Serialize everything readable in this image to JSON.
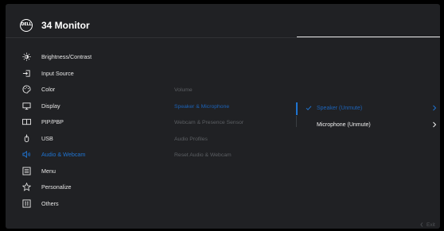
{
  "header": {
    "brand": "DELL",
    "title": "34 Monitor"
  },
  "menu": {
    "items": [
      {
        "label": "Brightness/Contrast",
        "icon": "brightness-icon"
      },
      {
        "label": "Input Source",
        "icon": "input-source-icon"
      },
      {
        "label": "Color",
        "icon": "color-icon"
      },
      {
        "label": "Display",
        "icon": "display-icon"
      },
      {
        "label": "PIP/PBP",
        "icon": "pip-pbp-icon"
      },
      {
        "label": "USB",
        "icon": "usb-icon"
      },
      {
        "label": "Audio & Webcam",
        "icon": "speaker-icon",
        "active": true
      },
      {
        "label": "Menu",
        "icon": "menu-icon"
      },
      {
        "label": "Personalize",
        "icon": "star-icon"
      },
      {
        "label": "Others",
        "icon": "others-icon"
      }
    ]
  },
  "submenu": {
    "items": [
      {
        "label": "Volume"
      },
      {
        "label": "Speaker & Microphone",
        "active": true
      },
      {
        "label": "Webcam & Presence Sensor"
      },
      {
        "label": "Audio Profiles"
      },
      {
        "label": "Reset Audio & Webcam"
      }
    ]
  },
  "detail": {
    "items": [
      {
        "label": "Speaker (Unmute)",
        "selected": true
      },
      {
        "label": "Microphone (Unmute)",
        "selected": false
      }
    ]
  },
  "footer": {
    "exit_label": "Exit"
  },
  "colors": {
    "background": "#202124",
    "accent": "#1f74d1",
    "text": "#e6e6e6",
    "dimmed_text": "#5c5f63"
  }
}
